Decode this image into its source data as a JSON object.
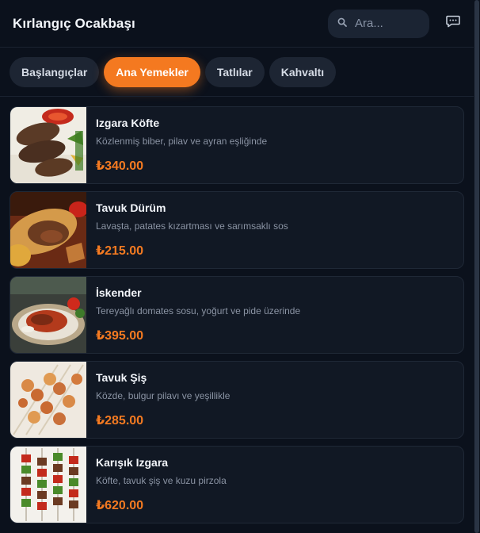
{
  "header": {
    "title": "Kırlangıç Ocakbaşı",
    "search_placeholder": "Ara..."
  },
  "tabs": [
    {
      "label": "Başlangıçlar",
      "active": false
    },
    {
      "label": "Ana Yemekler",
      "active": true
    },
    {
      "label": "Tatlılar",
      "active": false
    },
    {
      "label": "Kahvaltı",
      "active": false
    }
  ],
  "menu": {
    "items": [
      {
        "name": "Izgara Köfte",
        "description": "Közlenmiş biber, pilav ve ayran eşliğinde",
        "price": "₺340.00"
      },
      {
        "name": "Tavuk Dürüm",
        "description": "Lavaşta, patates kızartması ve sarımsaklı sos",
        "price": "₺215.00"
      },
      {
        "name": "İskender",
        "description": "Tereyağlı domates sosu, yoğurt ve pide üzerinde",
        "price": "₺395.00"
      },
      {
        "name": "Tavuk Şiş",
        "description": "Közde, bulgur pilavı ve yeşillikle",
        "price": "₺285.00"
      },
      {
        "name": "Karışık Izgara",
        "description": "Köfte, tavuk şiş ve kuzu pirzola",
        "price": "₺620.00"
      }
    ]
  },
  "colors": {
    "accent": "#f47920",
    "background": "#0b111c",
    "card": "#111824"
  },
  "icons": {
    "search": "search-icon",
    "message": "message-icon"
  }
}
